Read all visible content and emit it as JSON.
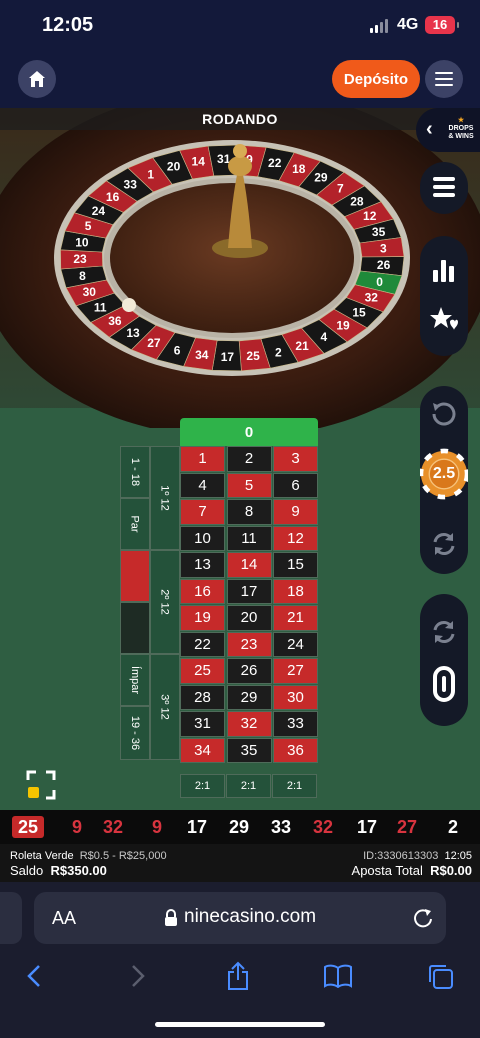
{
  "status_bar": {
    "time": "12:05",
    "network": "4G",
    "battery": "16"
  },
  "header": {
    "deposit_label": "Depósito",
    "home_icon": "home-icon",
    "menu_icon": "hamburger-icon"
  },
  "game": {
    "status": "RODANDO",
    "drops_logo": "DROPS & WINS",
    "wheel_numbers": [
      "20",
      "14",
      "31",
      "9",
      "22",
      "18",
      "29",
      "7",
      "28",
      "12",
      "35",
      "3",
      "26",
      "0",
      "32",
      "15",
      "19",
      "4",
      "21",
      "2",
      "25",
      "17",
      "34",
      "6",
      "27",
      "13",
      "36",
      "11",
      "30",
      "8",
      "23",
      "10",
      "5",
      "24",
      "16",
      "33",
      "1"
    ],
    "chip_value": "2.5"
  },
  "board": {
    "zero": "0",
    "numbers": [
      [
        "1",
        "red"
      ],
      [
        "2",
        "black"
      ],
      [
        "3",
        "red"
      ],
      [
        "4",
        "black"
      ],
      [
        "5",
        "red"
      ],
      [
        "6",
        "black"
      ],
      [
        "7",
        "red"
      ],
      [
        "8",
        "black"
      ],
      [
        "9",
        "red"
      ],
      [
        "10",
        "black"
      ],
      [
        "11",
        "black"
      ],
      [
        "12",
        "red"
      ],
      [
        "13",
        "black"
      ],
      [
        "14",
        "red"
      ],
      [
        "15",
        "black"
      ],
      [
        "16",
        "red"
      ],
      [
        "17",
        "black"
      ],
      [
        "18",
        "red"
      ],
      [
        "19",
        "red"
      ],
      [
        "20",
        "black"
      ],
      [
        "21",
        "red"
      ],
      [
        "22",
        "black"
      ],
      [
        "23",
        "red"
      ],
      [
        "24",
        "black"
      ],
      [
        "25",
        "red"
      ],
      [
        "26",
        "black"
      ],
      [
        "27",
        "red"
      ],
      [
        "28",
        "black"
      ],
      [
        "29",
        "black"
      ],
      [
        "30",
        "red"
      ],
      [
        "31",
        "black"
      ],
      [
        "32",
        "red"
      ],
      [
        "33",
        "black"
      ],
      [
        "34",
        "red"
      ],
      [
        "35",
        "black"
      ],
      [
        "36",
        "red"
      ]
    ],
    "columns": [
      "2:1",
      "2:1",
      "2:1"
    ],
    "dozens": [
      "1º 12",
      "2º 12",
      "3º 12"
    ],
    "outside": {
      "low": "1 - 18",
      "even": "Par",
      "odd": "Ímpar",
      "high": "19 - 36"
    }
  },
  "history": [
    {
      "n": "25",
      "c": "red"
    },
    {
      "n": "9",
      "c": "red"
    },
    {
      "n": "32",
      "c": "red"
    },
    {
      "n": "9",
      "c": "red"
    },
    {
      "n": "17",
      "c": "black"
    },
    {
      "n": "29",
      "c": "black"
    },
    {
      "n": "33",
      "c": "black"
    },
    {
      "n": "32",
      "c": "red"
    },
    {
      "n": "17",
      "c": "black"
    },
    {
      "n": "27",
      "c": "red"
    },
    {
      "n": "2",
      "c": "black"
    }
  ],
  "info": {
    "game_name": "Roleta Verde",
    "limits": "R$0.5 - R$25,000",
    "balance_label": "Saldo",
    "balance": "R$350.00",
    "round_id": "ID:3330613303",
    "clock": "12:05",
    "total_bet_label": "Aposta Total",
    "total_bet": "R$0.00"
  },
  "browser": {
    "aa_label": "AA",
    "domain": "ninecasino.com"
  },
  "colors": {
    "accent": "#f05a1a",
    "red": "#c62a2a",
    "green": "#2fb34a",
    "felt": "#2f5e42"
  }
}
